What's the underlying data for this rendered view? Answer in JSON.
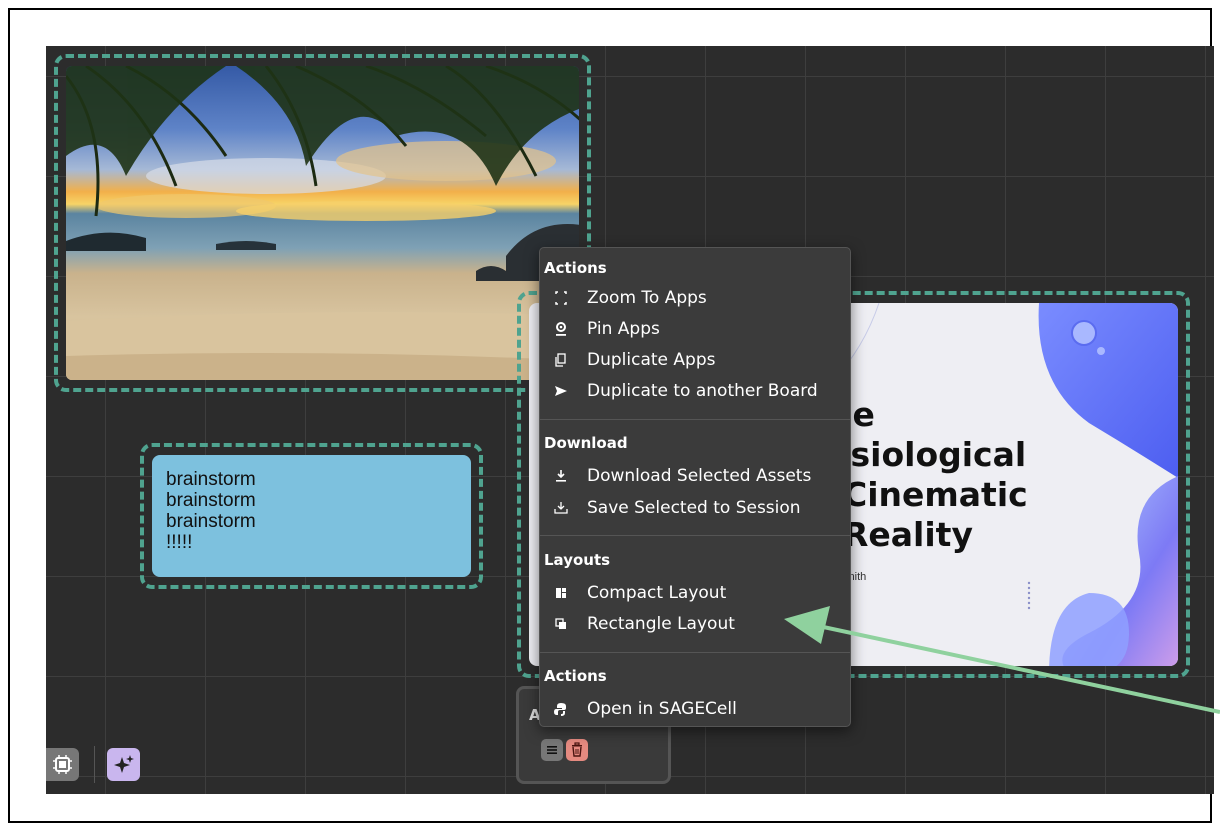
{
  "note": {
    "lines": [
      "brainstorm",
      "brainstorm",
      "brainstorm",
      "!!!!!"
    ]
  },
  "slide": {
    "title_lines": [
      "ne",
      "ysiological",
      "Cinematic",
      "Reality"
    ],
    "author": "n Smith"
  },
  "bottom_card": {
    "letter": "A"
  },
  "menu": {
    "sections": [
      {
        "header": "Actions",
        "items": [
          {
            "label": "Zoom To Apps",
            "icon": "zoom-fit-icon"
          },
          {
            "label": "Pin Apps",
            "icon": "pin-icon"
          },
          {
            "label": "Duplicate Apps",
            "icon": "duplicate-icon"
          },
          {
            "label": "Duplicate to another Board",
            "icon": "send-icon"
          }
        ]
      },
      {
        "header": "Download",
        "items": [
          {
            "label": "Download Selected Assets",
            "icon": "download-icon"
          },
          {
            "label": "Save Selected to Session",
            "icon": "save-tray-icon"
          }
        ]
      },
      {
        "header": "Layouts",
        "items": [
          {
            "label": "Compact Layout",
            "icon": "compact-layout-icon"
          },
          {
            "label": "Rectangle Layout",
            "icon": "rectangle-layout-icon"
          }
        ]
      },
      {
        "header": "Actions",
        "items": [
          {
            "label": "Open in SAGECell",
            "icon": "python-icon"
          }
        ]
      }
    ]
  },
  "colors": {
    "canvas": "#2c2c2c",
    "selection": "#4fa38f",
    "note": "#7dc1de",
    "menu": "#3b3b3b",
    "arrow": "#8fd19e"
  }
}
